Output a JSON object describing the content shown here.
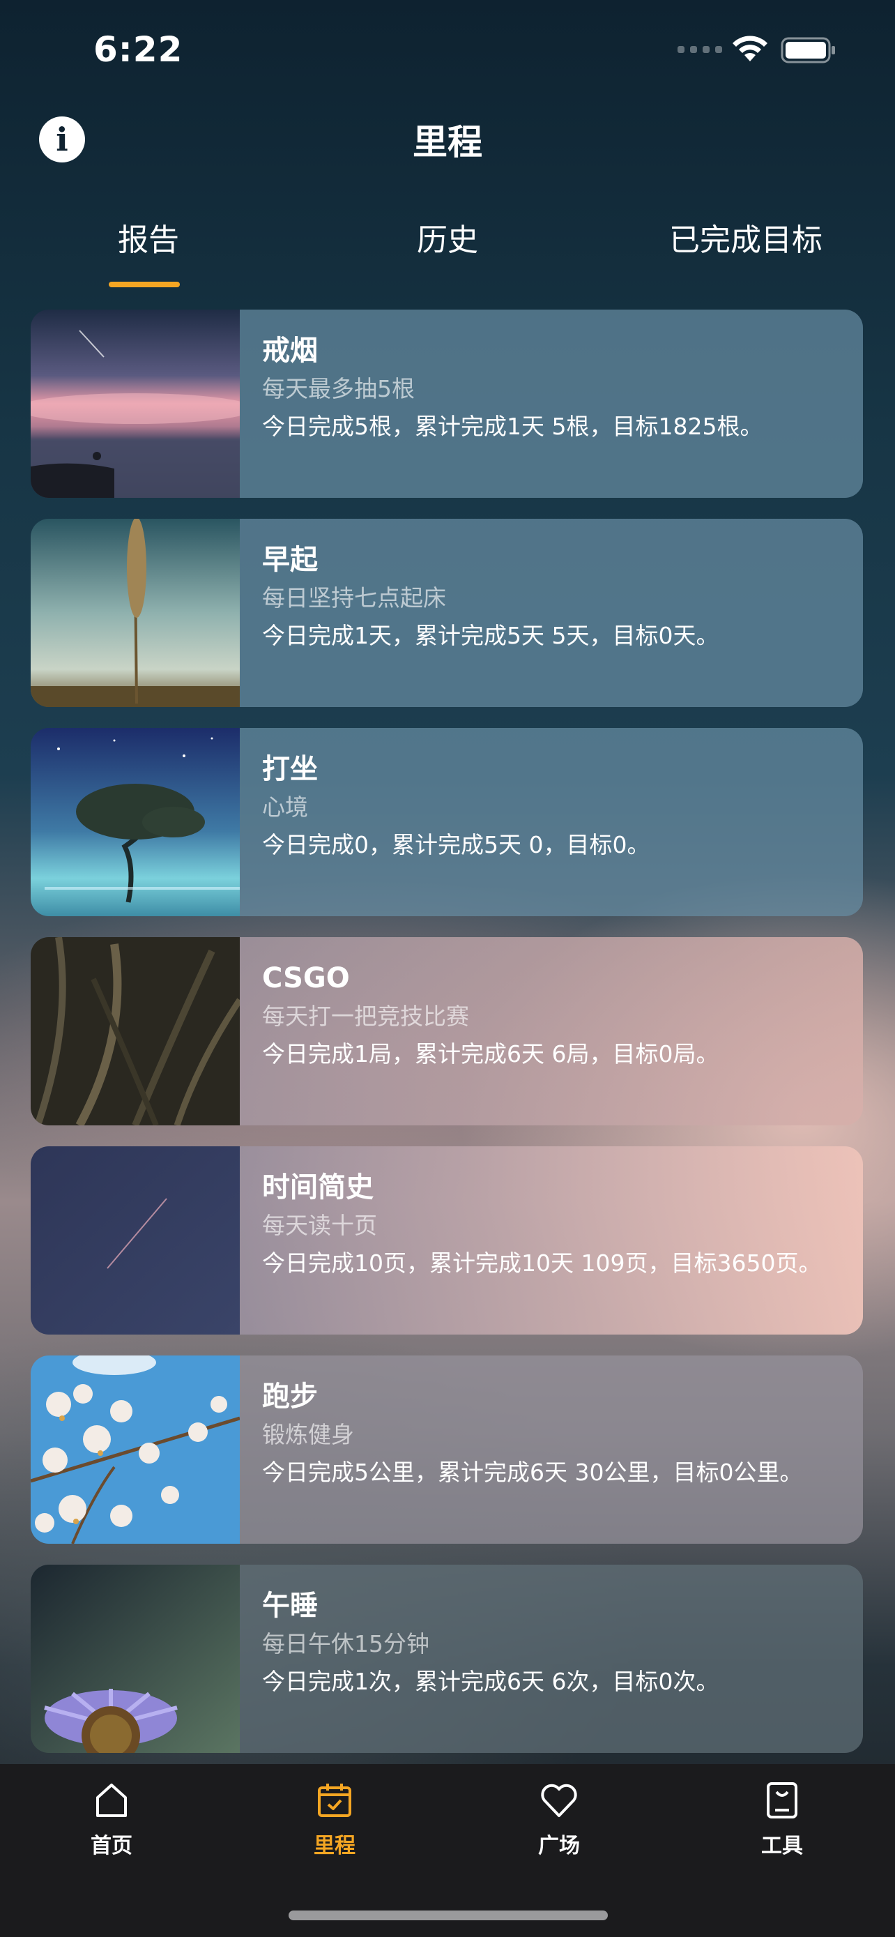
{
  "status": {
    "time": "6:22"
  },
  "header": {
    "title": "里程",
    "info_icon": "info-icon"
  },
  "tabs": [
    {
      "label": "报告",
      "active": true
    },
    {
      "label": "历史",
      "active": false
    },
    {
      "label": "已完成目标",
      "active": false
    }
  ],
  "accent_color": "#f5a623",
  "goals": [
    {
      "title": "戒烟",
      "subtitle": "每天最多抽5根",
      "progress": "今日完成5根，累计完成1天 5根，目标1825根。",
      "image": "sunset-sea-photo"
    },
    {
      "title": "早起",
      "subtitle": "每日坚持七点起床",
      "progress": "今日完成1天，累计完成5天 5天，目标0天。",
      "image": "grass-stalk-photo"
    },
    {
      "title": "打坐",
      "subtitle": "心境",
      "progress": "今日完成0，累计完成5天 0，目标0。",
      "image": "lone-tree-night-photo"
    },
    {
      "title": "CSGO",
      "subtitle": "每天打一把竞技比赛",
      "progress": "今日完成1局，累计完成6天 6局，目标0局。",
      "image": "dark-grass-photo"
    },
    {
      "title": "时间简史",
      "subtitle": "每天读十页",
      "progress": "今日完成10页，累计完成10天 109页，目标3650页。",
      "image": "shooting-star-photo"
    },
    {
      "title": "跑步",
      "subtitle": "锻炼健身",
      "progress": "今日完成5公里，累计完成6天 30公里，目标0公里。",
      "image": "blossom-sky-photo"
    },
    {
      "title": "午睡",
      "subtitle": "每日午休15分钟",
      "progress": "今日完成1次，累计完成6天 6次，目标0次。",
      "image": "purple-flower-photo"
    }
  ],
  "tabbar": [
    {
      "label": "首页",
      "icon": "home-icon",
      "active": false
    },
    {
      "label": "里程",
      "icon": "calendar-check-icon",
      "active": true
    },
    {
      "label": "广场",
      "icon": "heart-icon",
      "active": false
    },
    {
      "label": "工具",
      "icon": "toolbox-icon",
      "active": false
    }
  ]
}
